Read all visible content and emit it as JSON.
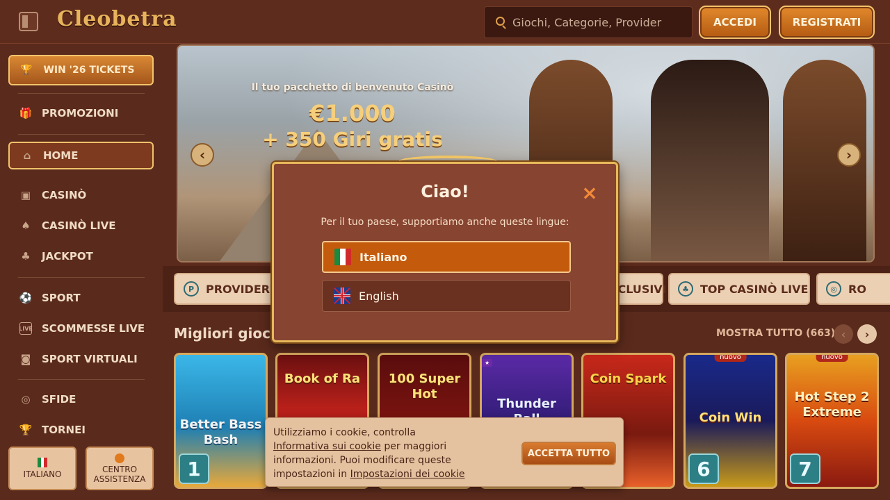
{
  "header": {
    "logo_text": "Cleobetra",
    "search_placeholder": "Giochi, Categorie, Provider",
    "login_label": "ACCEDI",
    "register_label": "REGISTRATI"
  },
  "sidebar": {
    "win_tickets_label": "WIN '26 TICKETS",
    "items": [
      {
        "label": "PROMOZIONI",
        "icon": "gift-icon"
      },
      {
        "label": "HOME",
        "icon": "home-icon",
        "active": true
      },
      {
        "label": "CASINÒ",
        "icon": "slot-machine-icon"
      },
      {
        "label": "CASINÒ LIVE",
        "icon": "cards-icon"
      },
      {
        "label": "JACKPOT",
        "icon": "clover-icon"
      },
      {
        "label": "SPORT",
        "icon": "ball-icon"
      },
      {
        "label": "SCOMMESSE LIVE",
        "icon": "live-icon"
      },
      {
        "label": "SPORT VIRTUALI",
        "icon": "virtual-ball-icon"
      },
      {
        "label": "SFIDE",
        "icon": "target-icon"
      },
      {
        "label": "TORNEI",
        "icon": "trophy-icon"
      }
    ],
    "language_label": "ITALIANO",
    "help_label": "CENTRO ASSISTENZA"
  },
  "banner": {
    "line1": "Il tuo pacchetto di benvenuto Casinò",
    "line2": "€1.000",
    "line3": "+ 350 Giri gratis"
  },
  "categories": [
    {
      "label": "PROVIDER"
    },
    {
      "label": "ESCLUSIVI"
    },
    {
      "label": "TOP CASINÒ LIVE"
    },
    {
      "label": "RO"
    }
  ],
  "games_section": {
    "title": "Migliori giochi",
    "show_all": "MOSTRA TUTTO (663)",
    "games": [
      {
        "name": "Better Bass Bash",
        "rank": "1",
        "badge": ""
      },
      {
        "name": "Book of Ra",
        "rank": "",
        "badge": ""
      },
      {
        "name": "100 Super Hot",
        "rank": "",
        "badge": ""
      },
      {
        "name": "Thunder Ball",
        "rank": "",
        "badge": ""
      },
      {
        "name": "Coin Spark",
        "rank": "",
        "badge": ""
      },
      {
        "name": "Coin Win",
        "rank": "6",
        "badge": "nuovo"
      },
      {
        "name": "Hot Step 2 Extreme",
        "rank": "7",
        "badge": "nuovo"
      }
    ]
  },
  "modal": {
    "title": "Ciao!",
    "subtitle": "Per il tuo paese, supportiamo anche queste lingue:",
    "option_italian": "Italiano",
    "option_english": "English"
  },
  "cookie": {
    "text1": "Utilizziamo i cookie, controlla",
    "link1": "Informativa sui cookie",
    "text2": " per maggiori informazioni. Puoi modificare queste impostazioni in ",
    "link2": "Impostazioni dei cookie",
    "accept_label": "ACCETTA TUTTO"
  }
}
